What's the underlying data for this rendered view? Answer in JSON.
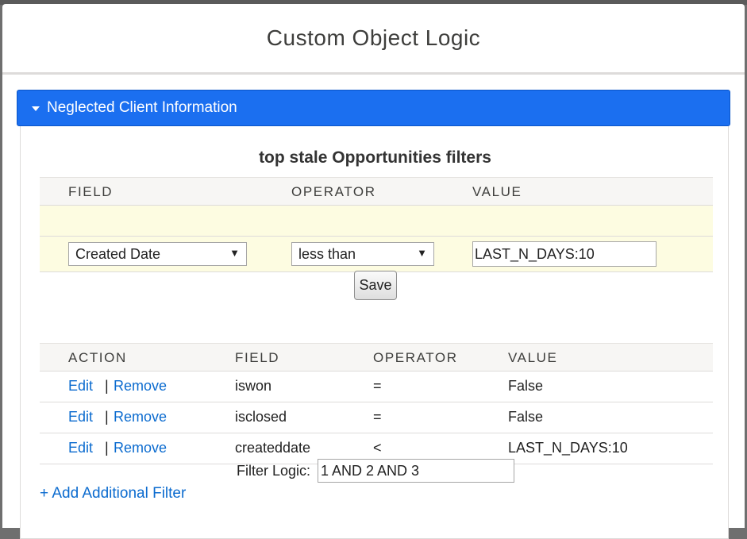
{
  "modal": {
    "title": "Custom Object Logic"
  },
  "section": {
    "title": "Neglected Client Information"
  },
  "filters": {
    "title": "top stale Opportunities filters",
    "columns": {
      "field": "FIELD",
      "operator": "OPERATOR",
      "value": "VALUE"
    },
    "editor": {
      "field_selected": "Created Date",
      "operator_selected": "less than",
      "value": "LAST_N_DAYS:10"
    },
    "save_label": "Save"
  },
  "criteria": {
    "columns": {
      "action": "ACTION",
      "field": "FIELD",
      "operator": "OPERATOR",
      "value": "VALUE"
    },
    "edit_label": "Edit",
    "separator": "|",
    "remove_label": "Remove",
    "rows": [
      {
        "field": "iswon",
        "operator": "=",
        "value": "False"
      },
      {
        "field": "isclosed",
        "operator": "=",
        "value": "False"
      },
      {
        "field": "createddate",
        "operator": "<",
        "value": "LAST_N_DAYS:10"
      }
    ]
  },
  "filter_logic": {
    "label": "Filter Logic:",
    "value": "1 AND 2 AND 3"
  },
  "add_filter_label": "+ Add Additional Filter",
  "icons": {
    "dropdown": "dropdown-arrow-icon",
    "section_toggle": "caret-down-icon"
  },
  "colors": {
    "section_header": "#1b6ff0",
    "link": "#0b6bcf",
    "editor_row": "#fdfce1"
  }
}
